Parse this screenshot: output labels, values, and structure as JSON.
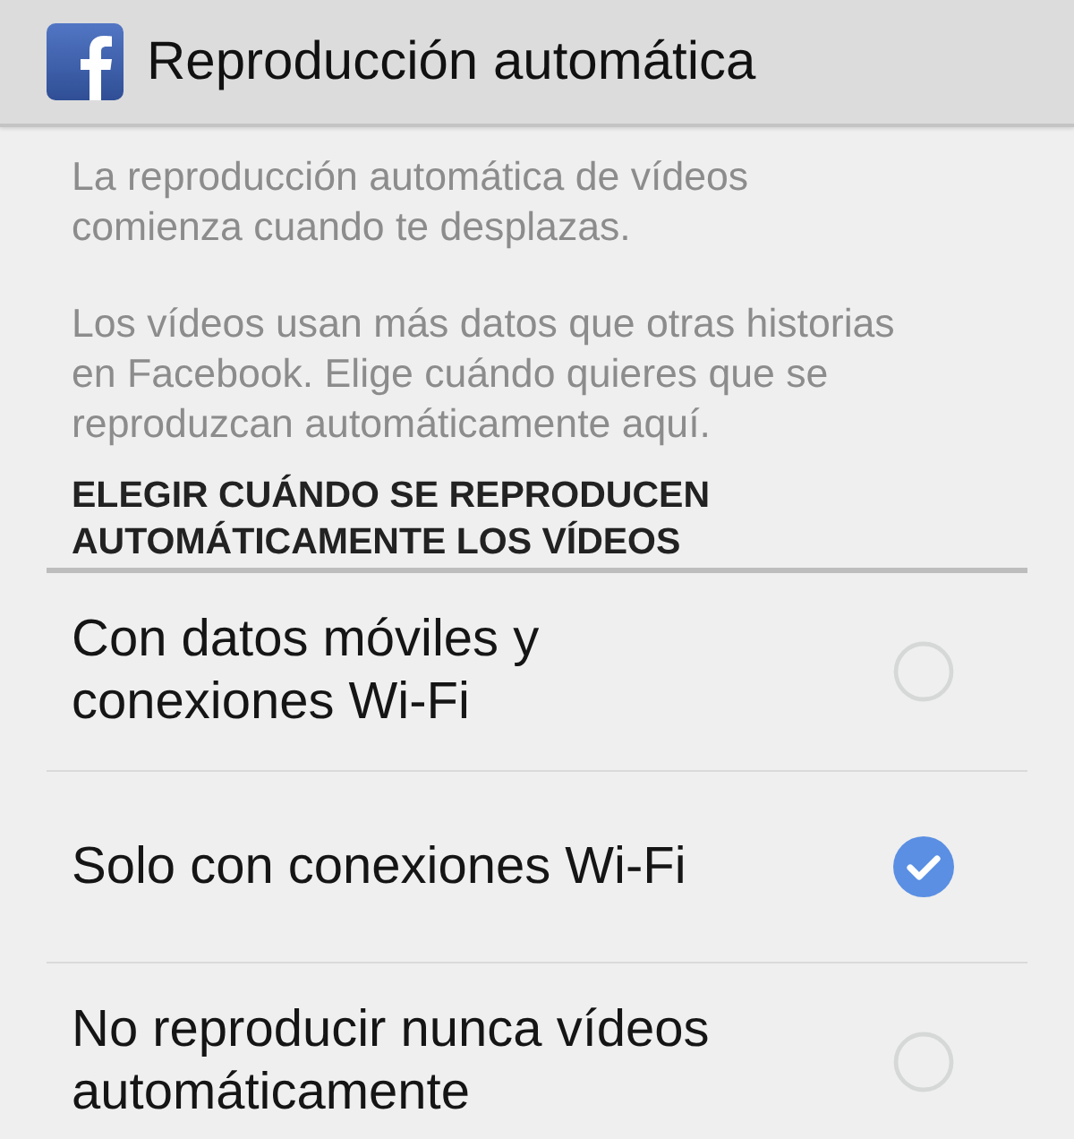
{
  "header": {
    "title": "Reproducción automática"
  },
  "description": [
    "La reproducción automática de vídeos comienza cuando te desplazas.",
    "Los vídeos usan más datos que otras historias en Facebook. Elige cuándo quieres que se reproduzcan automáticamente aquí."
  ],
  "section": {
    "heading": "ELEGIR CUÁNDO SE REPRODUCEN AUTOMÁTICAMENTE LOS VÍDEOS"
  },
  "options": [
    {
      "label": "Con datos móviles y conexiones Wi-Fi",
      "selected": false
    },
    {
      "label": "Solo con conexiones Wi-Fi",
      "selected": true
    },
    {
      "label": "No reproducir nunca vídeos automáticamente",
      "selected": false
    }
  ]
}
